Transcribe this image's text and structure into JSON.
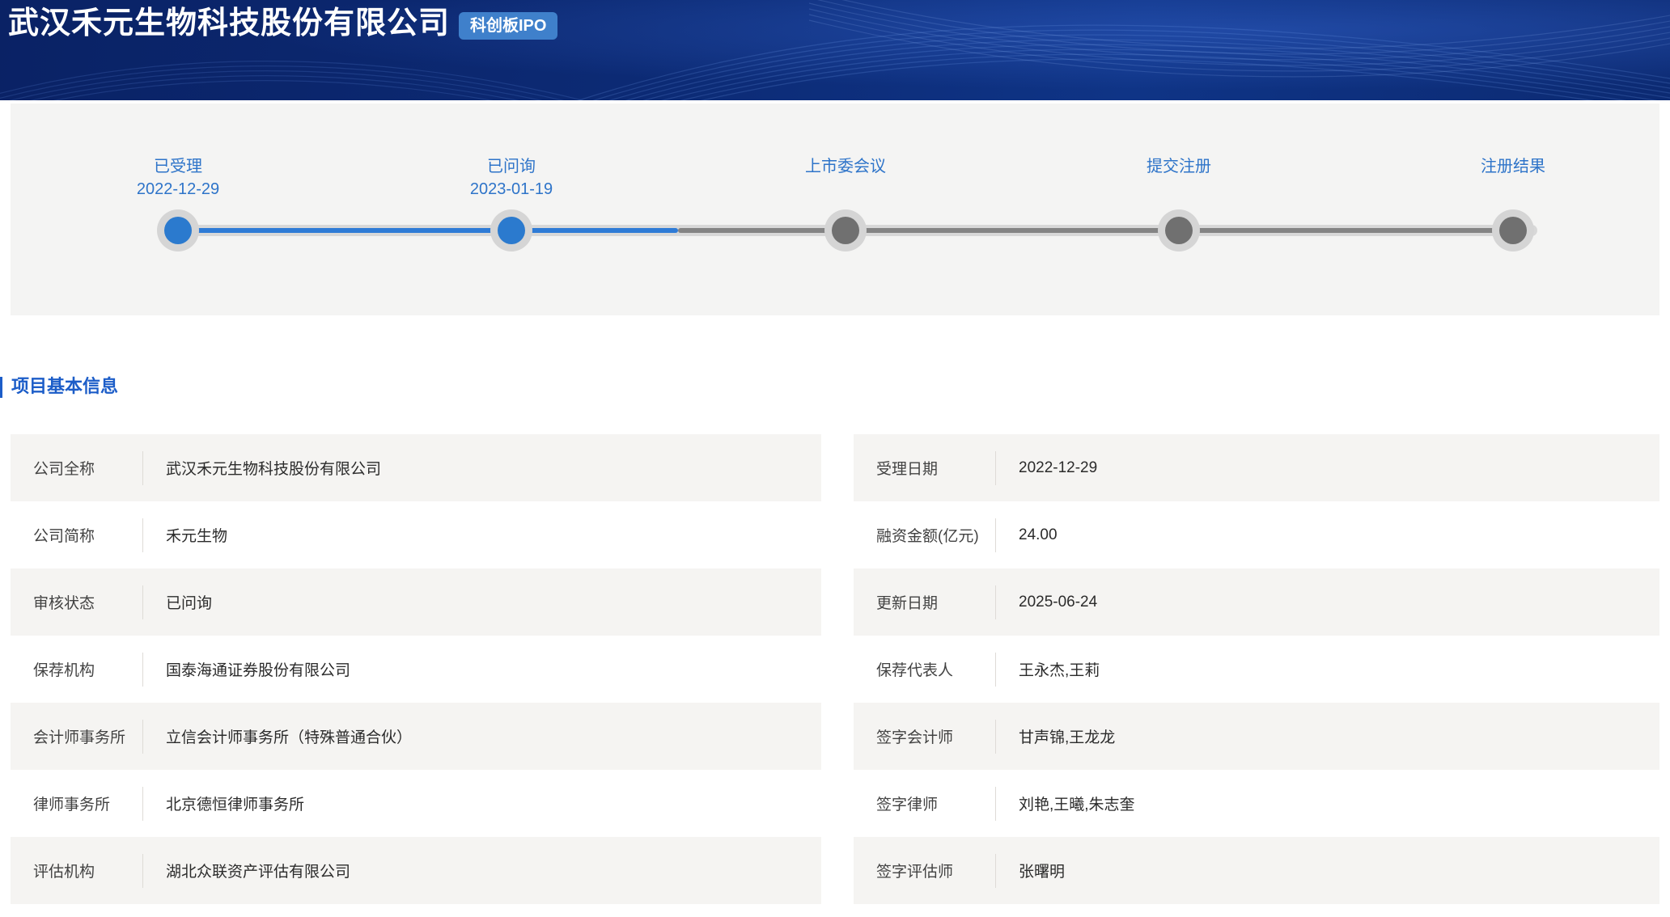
{
  "header": {
    "company_name": "武汉禾元生物科技股份有限公司",
    "badge": "科创板IPO",
    "badge_color": "#3f80cb",
    "background_color": "#0c2a74"
  },
  "timeline": {
    "steps": [
      {
        "label": "已受理",
        "date": "2022-12-29",
        "status": "done"
      },
      {
        "label": "已问询",
        "date": "2023-01-19",
        "status": "done"
      },
      {
        "label": "上市委会议",
        "date": "",
        "status": "pending"
      },
      {
        "label": "提交注册",
        "date": "",
        "status": "pending"
      },
      {
        "label": "注册结果",
        "date": "",
        "status": "pending"
      }
    ],
    "done_color": "#2b7ace",
    "pending_color": "#707070",
    "label_color": "#2e74c9"
  },
  "section": {
    "title": "项目基本信息",
    "title_color": "#1c5dc8"
  },
  "info": {
    "left": [
      {
        "label": "公司全称",
        "value": "武汉禾元生物科技股份有限公司"
      },
      {
        "label": "公司简称",
        "value": "禾元生物"
      },
      {
        "label": "审核状态",
        "value": "已问询"
      },
      {
        "label": "保荐机构",
        "value": "国泰海通证券股份有限公司"
      },
      {
        "label": "会计师事务所",
        "value": "立信会计师事务所（特殊普通合伙）"
      },
      {
        "label": "律师事务所",
        "value": "北京德恒律师事务所"
      },
      {
        "label": "评估机构",
        "value": "湖北众联资产评估有限公司"
      }
    ],
    "right": [
      {
        "label": "受理日期",
        "value": "2022-12-29"
      },
      {
        "label": "融资金额(亿元)",
        "value": "24.00"
      },
      {
        "label": "更新日期",
        "value": "2025-06-24"
      },
      {
        "label": "保荐代表人",
        "value": "王永杰,王莉"
      },
      {
        "label": "签字会计师",
        "value": "甘声锦,王龙龙"
      },
      {
        "label": "签字律师",
        "value": "刘艳,王曦,朱志奎"
      },
      {
        "label": "签字评估师",
        "value": "张曙明"
      }
    ]
  }
}
